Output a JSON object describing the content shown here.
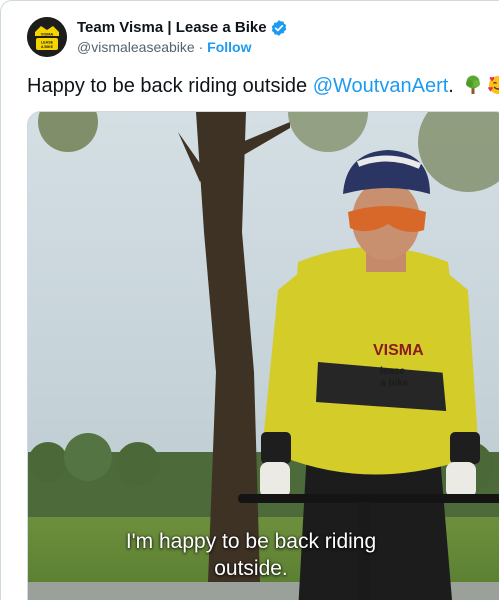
{
  "tweet": {
    "display_name": "Team Visma | Lease a Bike",
    "handle": "@vismaleaseabike",
    "separator": " · ",
    "follow_label": "Follow",
    "text_before": "Happy to be back riding outside ",
    "mention": "@WoutvanAert",
    "text_after": ".",
    "emojis": [
      "tree-emoji",
      "smiling-face-with-hearts-emoji"
    ]
  },
  "avatar": {
    "logo_lines": [
      "VISMA",
      "LEASE",
      "A BIKE"
    ]
  },
  "media": {
    "caption_line1": "I'm happy to be back riding",
    "caption_line2": "outside.",
    "jersey_text": [
      "VISMA",
      "lease",
      "a bike"
    ]
  },
  "colors": {
    "accent": "#1d9bf0",
    "jersey_yellow": "#d4cc29",
    "text": "#0f1419",
    "secondary": "#536471"
  }
}
